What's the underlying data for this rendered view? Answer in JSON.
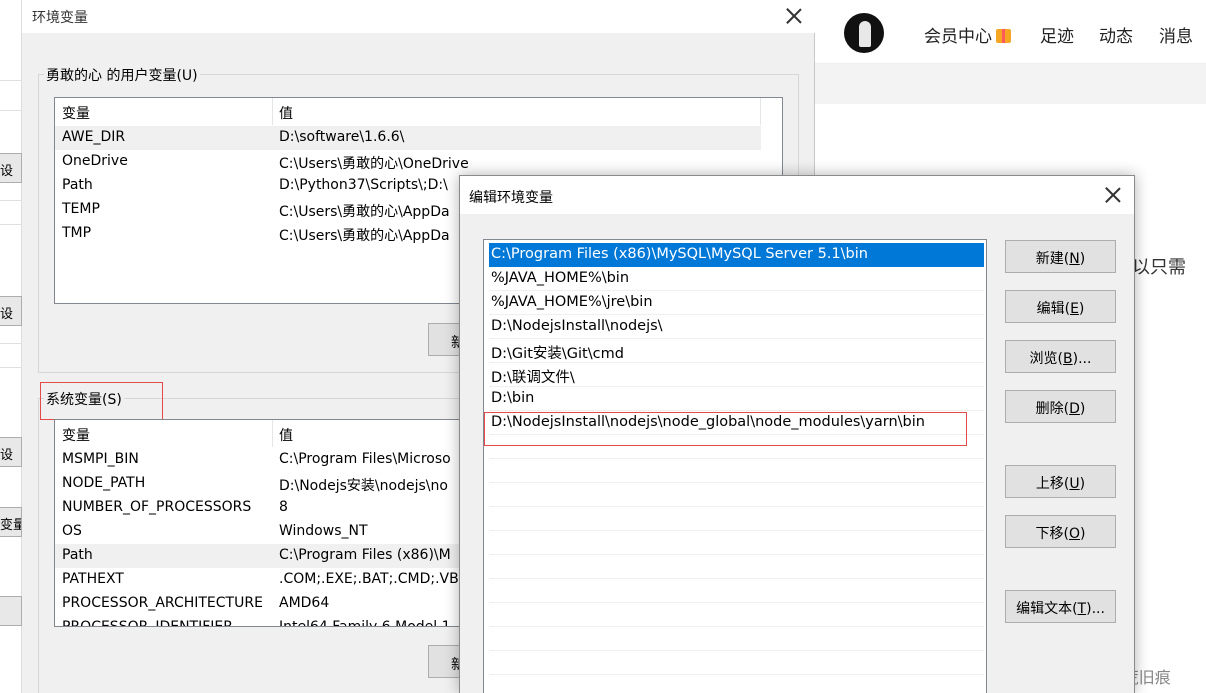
{
  "background_page": {
    "nav": [
      "会员中心",
      "足迹",
      "动态",
      "消息"
    ],
    "side_text": "以只需",
    "watermark": "CSDN @拾荒旧痕",
    "left_strip_buttons": [
      "设",
      "设",
      "设",
      "变量"
    ]
  },
  "env_dialog": {
    "title": "环境变量",
    "user_group_label": "勇敢的心 的用户变量(U)",
    "user_columns": [
      "变量",
      "值"
    ],
    "user_rows": [
      {
        "name": "AWE_DIR",
        "value": "D:\\software\\1.6.6\\"
      },
      {
        "name": "OneDrive",
        "value": "C:\\Users\\勇敢的心\\OneDrive"
      },
      {
        "name": "Path",
        "value": "D:\\Python37\\Scripts\\;D:\\"
      },
      {
        "name": "TEMP",
        "value": "C:\\Users\\勇敢的心\\AppDa"
      },
      {
        "name": "TMP",
        "value": "C:\\Users\\勇敢的心\\AppDa"
      }
    ],
    "user_new_button": "新",
    "system_group_label": "系统变量(S)",
    "system_columns": [
      "变量",
      "值"
    ],
    "system_rows": [
      {
        "name": "MSMPI_BIN",
        "value": "C:\\Program Files\\Microso"
      },
      {
        "name": "NODE_PATH",
        "value": "D:\\Nodejs安装\\nodejs\\no"
      },
      {
        "name": "NUMBER_OF_PROCESSORS",
        "value": "8"
      },
      {
        "name": "OS",
        "value": "Windows_NT"
      },
      {
        "name": "Path",
        "value": "C:\\Program Files (x86)\\M"
      },
      {
        "name": "PATHEXT",
        "value": ".COM;.EXE;.BAT;.CMD;.VB"
      },
      {
        "name": "PROCESSOR_ARCHITECTURE",
        "value": "AMD64"
      },
      {
        "name": "PROCESSOR_IDENTIFIER",
        "value": "Intel64 Family 6 Model 1"
      }
    ],
    "system_new_button": "新"
  },
  "edit_dialog": {
    "title": "编辑环境变量",
    "entries": [
      "C:\\Program Files (x86)\\MySQL\\MySQL Server 5.1\\bin",
      "%JAVA_HOME%\\bin",
      "%JAVA_HOME%\\jre\\bin",
      "D:\\NodejsInstall\\nodejs\\",
      "D:\\Git安装\\Git\\cmd",
      "D:\\联调文件\\",
      "D:\\bin",
      "D:\\NodejsInstall\\nodejs\\node_global\\node_modules\\yarn\\bin"
    ],
    "buttons": {
      "new": {
        "text": "新建(",
        "key": "N",
        "tail": ")"
      },
      "edit": {
        "text": "编辑(",
        "key": "E",
        "tail": ")"
      },
      "browse": {
        "text": "浏览(",
        "key": "B",
        "tail": ")..."
      },
      "delete": {
        "text": "删除(",
        "key": "D",
        "tail": ")"
      },
      "move_up": {
        "text": "上移(",
        "key": "U",
        "tail": ")"
      },
      "move_down": {
        "text": "下移(",
        "key": "O",
        "tail": ")"
      },
      "edit_text": {
        "text": "编辑文本(",
        "key": "T",
        "tail": ")..."
      }
    }
  },
  "colors": {
    "selection": "#0078d7",
    "highlight_box": "#e34b4b",
    "dialog_bg": "#f0f0f0"
  }
}
